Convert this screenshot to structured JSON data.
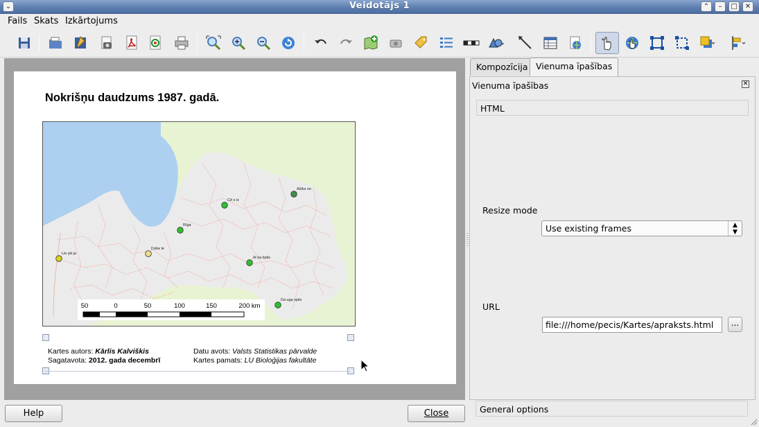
{
  "window": {
    "title": "Veidotājs 1"
  },
  "menu": {
    "items": [
      "Fails",
      "Skats",
      "Izkārtojums"
    ]
  },
  "toolbar": {
    "tools": [
      "save-icon",
      "open-template-icon",
      "save-template-icon",
      "export-image-icon",
      "export-pdf-icon",
      "export-svg-icon",
      "print-icon",
      "zoom-full-icon",
      "zoom-in-icon",
      "zoom-out-icon",
      "refresh-icon",
      "undo-icon",
      "redo-icon",
      "add-map-icon",
      "add-image-icon",
      "add-label-icon",
      "add-legend-icon",
      "add-scalebar-icon",
      "add-shape-icon",
      "add-arrow-icon",
      "add-table-icon",
      "add-html-icon",
      "select-move-icon",
      "move-content-icon",
      "group-icon",
      "ungroup-icon",
      "raise-icon",
      "align-icon"
    ]
  },
  "composition": {
    "title": "Nokrišņu daudzums 1987. gadā.",
    "map": {
      "colors": {
        "water": "#aed0f0",
        "land": "#e8f3d3",
        "latvia": "#ebebeb",
        "borders": "#f0a9a0"
      },
      "cities": [
        {
          "name": "Alūksne",
          "label": "Alūks ne",
          "color": "#3d8f4a"
        },
        {
          "name": "Cēsis",
          "label": "Cē s is",
          "color": "#2fbf2f"
        },
        {
          "name": "Rīga",
          "label": "Rīga",
          "color": "#2fbf2f"
        },
        {
          "name": "Liepāja",
          "label": "Lie pā ja",
          "color": "#d8d21c"
        },
        {
          "name": "Dobele",
          "label": "Dobe le",
          "color": "#f0dc8c"
        },
        {
          "name": "Jēkabpils",
          "label": "Jē ka bpils",
          "color": "#2fbf2f"
        },
        {
          "name": "Daugavpils",
          "label": "Da uga vpils",
          "color": "#2fbf2f"
        }
      ],
      "scalebar": {
        "labels": [
          "50",
          "0",
          "50",
          "100",
          "150",
          "200 km"
        ]
      }
    },
    "footer": {
      "author_label": "Kartes autors:",
      "author_value": "Kārlis Kalviškis",
      "prepared_label": "Sagatavota:",
      "prepared_value": "2012. gada decembrī",
      "source_label": "Datu avots:",
      "source_value": "Valsts Statistikas pārvalde",
      "base_label": "Kartes pamats:",
      "base_value": "LU Bioloģijas fakultāte"
    }
  },
  "panel": {
    "tabs": [
      "Kompozīcija",
      "Vienuma īpašības"
    ],
    "active_tab": "Vienuma īpašības",
    "heading": "Vienuma īpašības",
    "section": "HTML",
    "resize_mode_label": "Resize mode",
    "resize_mode_value": "Use existing frames",
    "url_label": "URL",
    "url_value": "file:///home/pecis/Kartes/apraksts.html",
    "browse_label": "...",
    "general_options": "General options"
  },
  "buttons": {
    "help": "Help",
    "close": "Close"
  }
}
